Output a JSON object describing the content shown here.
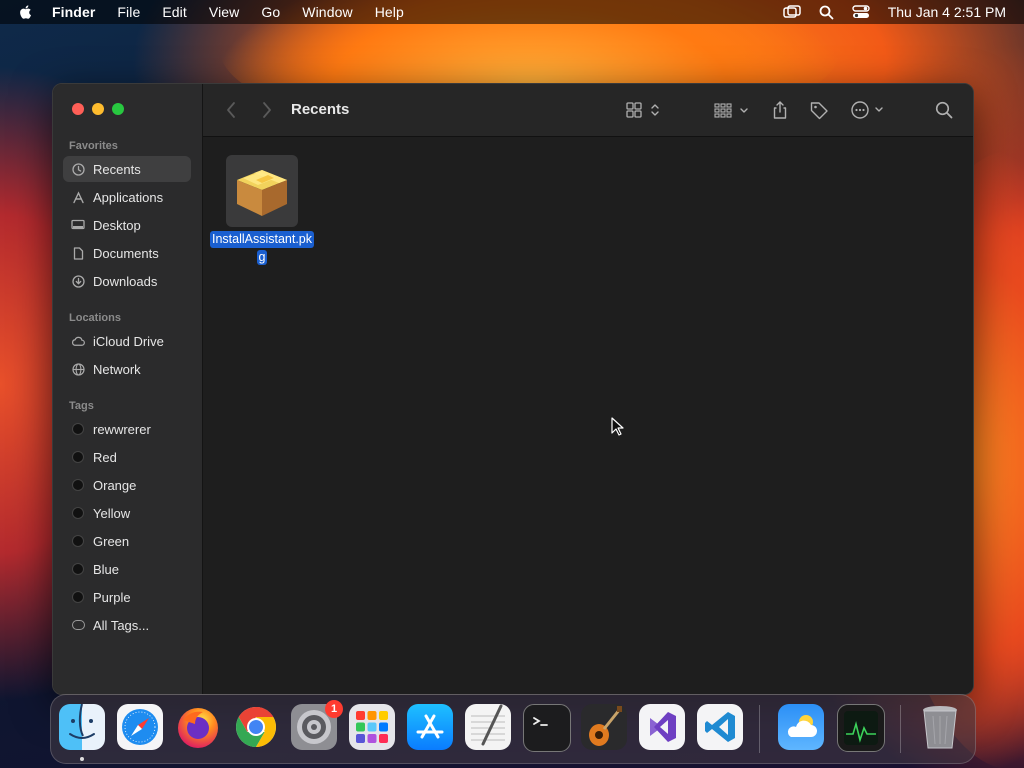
{
  "menubar": {
    "app_name": "Finder",
    "menus": [
      "File",
      "Edit",
      "View",
      "Go",
      "Window",
      "Help"
    ],
    "clock": "Thu Jan 4  2:51 PM",
    "status_icons": [
      "screen-mirroring-icon",
      "spotlight-search-icon",
      "control-center-icon"
    ]
  },
  "window": {
    "title": "Recents",
    "sidebar": {
      "favorites_title": "Favorites",
      "favorites": [
        {
          "label": "Recents",
          "icon": "clock-icon",
          "selected": true
        },
        {
          "label": "Applications",
          "icon": "applications-icon"
        },
        {
          "label": "Desktop",
          "icon": "desktop-icon"
        },
        {
          "label": "Documents",
          "icon": "document-icon"
        },
        {
          "label": "Downloads",
          "icon": "download-icon"
        }
      ],
      "locations_title": "Locations",
      "locations": [
        {
          "label": "iCloud Drive",
          "icon": "cloud-icon"
        },
        {
          "label": "Network",
          "icon": "globe-icon"
        }
      ],
      "tags_title": "Tags",
      "tags": [
        {
          "label": "rewwrerer"
        },
        {
          "label": "Red"
        },
        {
          "label": "Orange"
        },
        {
          "label": "Yellow"
        },
        {
          "label": "Green"
        },
        {
          "label": "Blue"
        },
        {
          "label": "Purple"
        },
        {
          "label": "All Tags...",
          "icon": "all-tags-icon"
        }
      ]
    },
    "files": [
      {
        "name_line1": "InstallAssistant.pk",
        "name_line2": "g",
        "icon": "package-icon",
        "selected": true
      }
    ]
  },
  "dock": {
    "apps": [
      "Finder",
      "Safari",
      "Firefox",
      "Chrome",
      "System Settings",
      "Launchpad",
      "App Store",
      "TextEdit",
      "Terminal",
      "GarageBand",
      "Visual Studio",
      "Visual Studio Code",
      "Weather",
      "Activity Monitor",
      "Trash"
    ],
    "settings_badge": "1"
  },
  "colors": {
    "selection_blue": "#1a5fd0",
    "window_bg": "#1e1e1e",
    "sidebar_bg": "#2b2b2c"
  }
}
